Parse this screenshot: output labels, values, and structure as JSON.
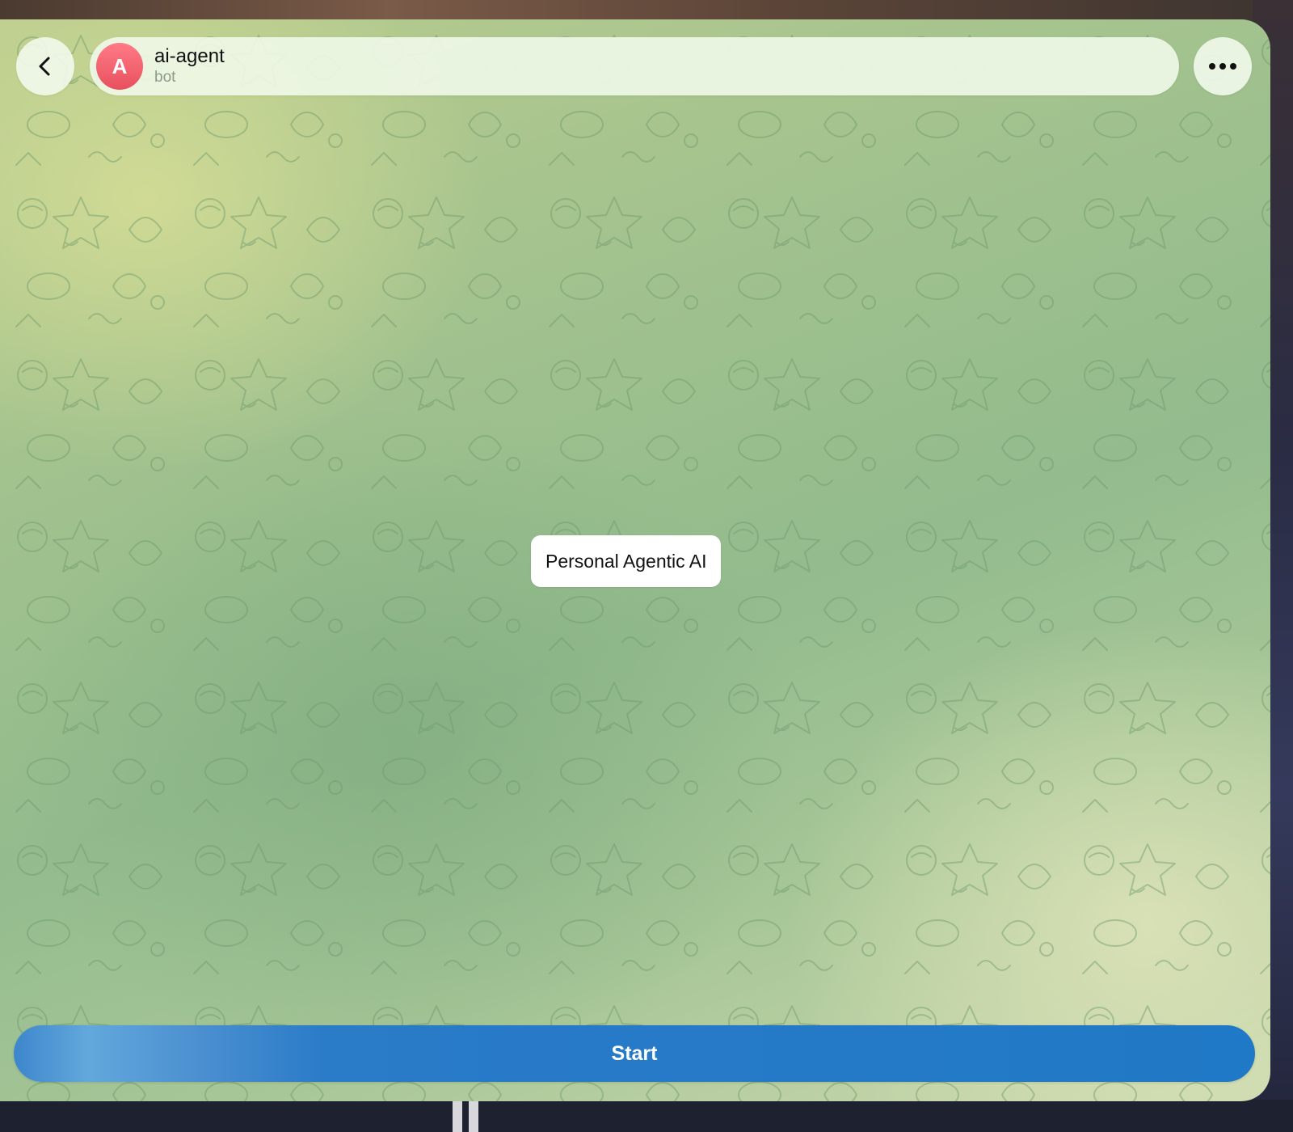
{
  "chat": {
    "avatar_letter": "A",
    "name": "ai-agent",
    "status": "bot"
  },
  "messages": [
    {
      "text": "Personal Agentic AI"
    }
  ],
  "actions": {
    "start_label": "Start"
  },
  "icons": {
    "back": "chevron-left-icon",
    "menu": "more-horizontal-icon"
  },
  "colors": {
    "avatar": "#e8505e",
    "start_button": "#2079c6",
    "wallpaper": "#a2c28e"
  }
}
